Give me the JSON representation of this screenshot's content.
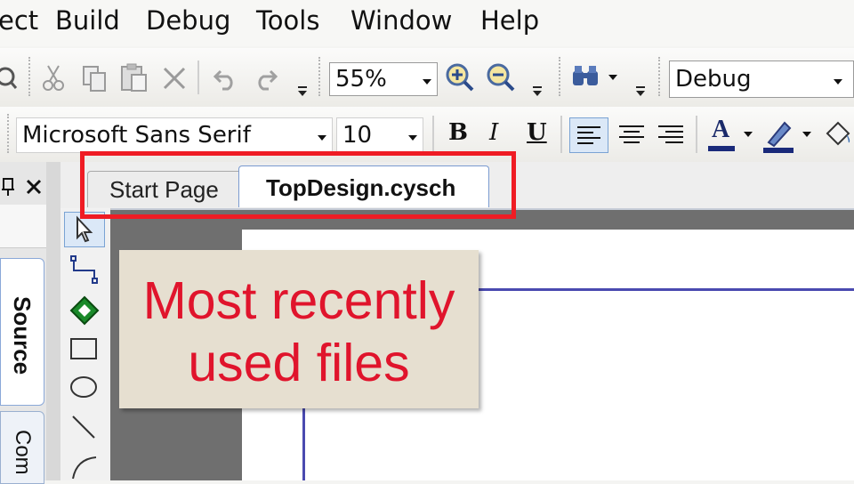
{
  "menu": {
    "items": [
      "ect",
      "Build",
      "Debug",
      "Tools",
      "Window",
      "Help"
    ]
  },
  "toolbar1": {
    "zoom_value": "55%",
    "config_value": "Debug"
  },
  "toolbar2": {
    "font_value": "Microsoft Sans Serif",
    "size_value": "10",
    "bold_label": "B",
    "italic_label": "I",
    "underline_label": "U",
    "font_color_label": "A"
  },
  "tabs": {
    "start_page": "Start Page",
    "active_doc": "TopDesign.cysch"
  },
  "side_tabs": {
    "source": "Source",
    "comp": "Com"
  },
  "callout": {
    "line1": "Most recently",
    "line2": "used files"
  },
  "colors": {
    "highlight": "#ef1c24",
    "callout_text": "#e0142c",
    "callout_bg": "#e6dfd0"
  }
}
